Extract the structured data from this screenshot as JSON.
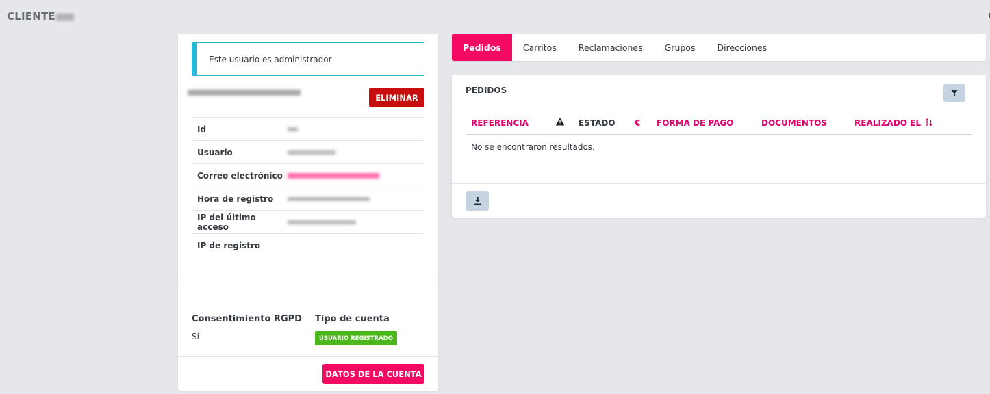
{
  "page": {
    "title": "CLIENTE"
  },
  "customer": {
    "admin_notice": "Este usuario es administrador",
    "delete_label": "ELIMINAR",
    "fields": {
      "id_label": "Id",
      "user_label": "Usuario",
      "email_label": "Correo electrónico",
      "registered_label": "Hora de registro",
      "last_ip_label": "IP del último acceso",
      "reg_ip_label": "IP de registro"
    },
    "gdpr_title": "Consentimiento RGPD",
    "gdpr_value": "Sí",
    "account_type_title": "Tipo de cuenta",
    "account_type_badge": "USUARIO REGISTRADO",
    "account_data_label": "DATOS DE LA CUENTA"
  },
  "tabs": [
    {
      "label": "Pedidos",
      "active": true
    },
    {
      "label": "Carritos",
      "active": false
    },
    {
      "label": "Reclamaciones",
      "active": false
    },
    {
      "label": "Grupos",
      "active": false
    },
    {
      "label": "Direcciones",
      "active": false
    }
  ],
  "orders": {
    "title": "PEDIDOS",
    "columns": {
      "reference": "REFERENCIA",
      "status": "ESTADO",
      "currency_symbol": "€",
      "payment": "FORMA DE PAGO",
      "documents": "DOCUMENTOS",
      "date": "REALIZADO EL"
    },
    "empty_message": "No se encontraron resultados."
  },
  "colors": {
    "accent": "#f50a63",
    "danger": "#c70d0d",
    "info": "#25b9d7",
    "success": "#4bb819",
    "background": "#e6e7eb"
  },
  "icons": [
    "warning-icon",
    "filter-icon",
    "sort-icon",
    "download-icon"
  ]
}
